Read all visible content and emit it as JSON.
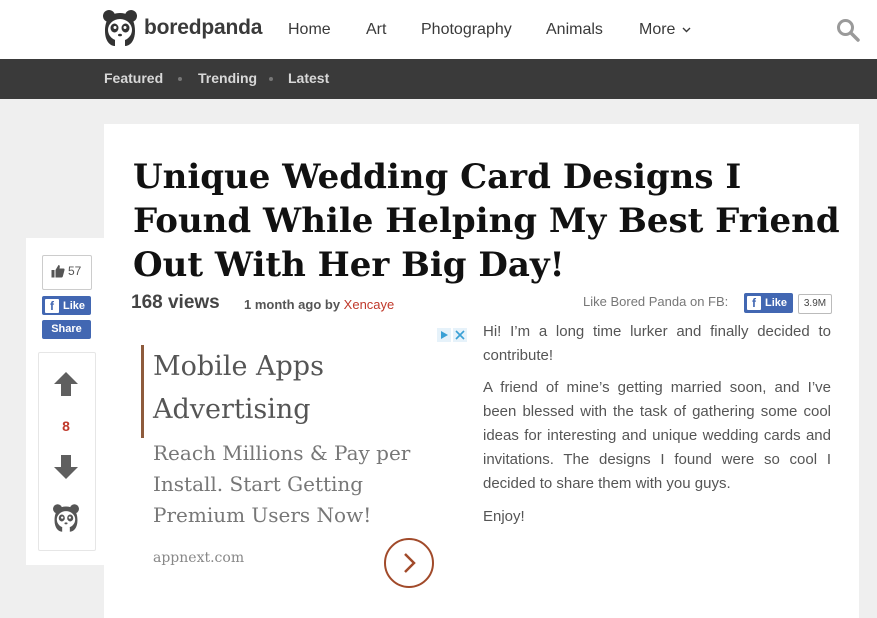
{
  "header": {
    "brand": "boredpanda",
    "nav": [
      "Home",
      "Art",
      "Photography",
      "Animals",
      "More"
    ],
    "more_chevron": "›"
  },
  "subnav": [
    "Featured",
    "Trending",
    "Latest"
  ],
  "article": {
    "title": "Unique Wedding Card Designs I Found While Helping My Best Friend Out With Her Big Day!",
    "views": "168 views",
    "posted": "1 month ago by ",
    "author": "Xencaye",
    "paragraphs": [
      "Hi! I’m a long time lurker and finally decided to contribute!",
      "A friend of mine’s getting married soon, and I’ve been blessed with the task of gathering some cool ideas for interesting and unique wedding cards and invitations. The designs I found were so cool I decided to share them with you guys.",
      "Enjoy!"
    ]
  },
  "fb": {
    "prompt": "Like Bored Panda on FB:",
    "like_label": "Like",
    "count": "3.9M"
  },
  "share": {
    "likes": "57",
    "like_label": "Like",
    "share_label": "Share",
    "votes": "8"
  },
  "ad": {
    "title": "Mobile Apps Advertising",
    "subtitle": "Reach Millions & Pay per Install. Start Getting Premium Users Now!",
    "domain": "appnext.com"
  },
  "colors": {
    "accent": "#c0392b",
    "facebook": "#4267b2",
    "subnav_bg": "#3a3a3a",
    "ad_brown": "#8e5b3c"
  }
}
